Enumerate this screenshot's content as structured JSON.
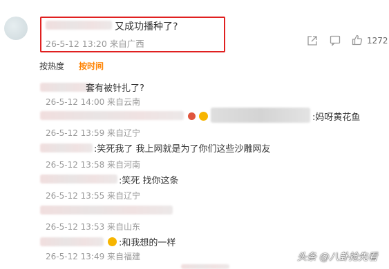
{
  "top_comment": {
    "text": "又成功播种了?",
    "meta": "26-5-12 13:20 来自广西",
    "like_count": "1272"
  },
  "sort_tabs": {
    "by_heat": "按热度",
    "by_time": "按时间"
  },
  "replies": [
    {
      "text": "套有被针扎了?",
      "meta": "26-5-12 14:00 来自云南"
    },
    {
      "text": ":妈呀黄花鱼",
      "meta": "26-5-12 13:59 来自辽宁"
    },
    {
      "text": ":笑死我了 我上网就是为了你们这些沙雕网友",
      "meta": "26-5-12 13:58 来自河南"
    },
    {
      "text": ":笑死 找你这条",
      "meta": "26-5-12 13:55 来自辽宁"
    },
    {
      "text": "",
      "meta": "26-5-12 13:53 来自山东"
    },
    {
      "text": ":和我想的一样",
      "meta": "26-5-12 13:49 来自福建"
    }
  ],
  "watermark": "头条 @八卦抢先看"
}
